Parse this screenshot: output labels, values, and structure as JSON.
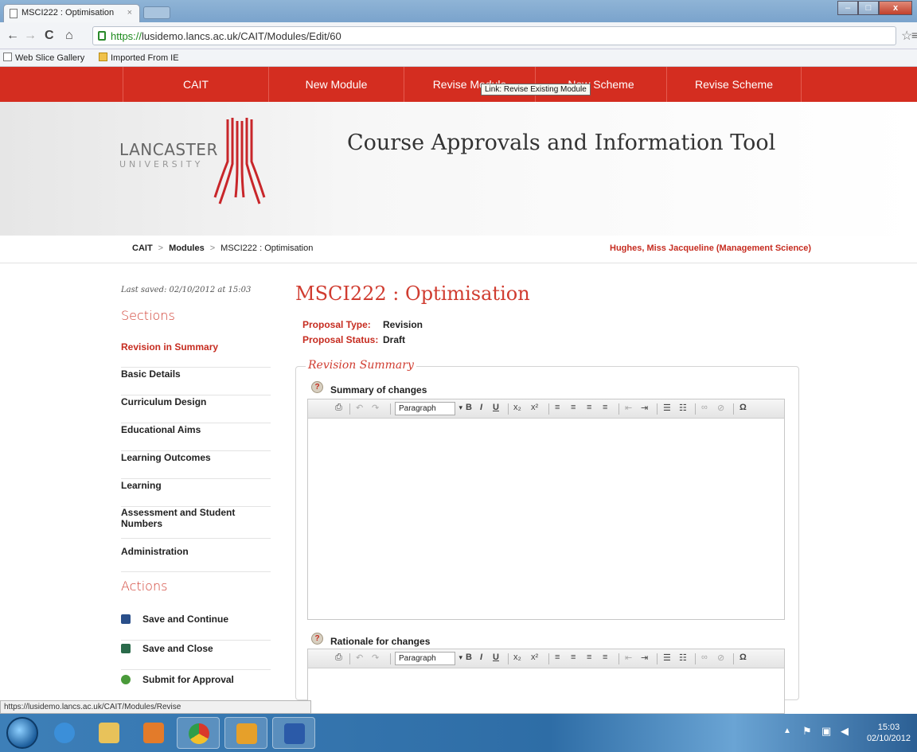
{
  "browser": {
    "tab_title": "MSCI222 : Optimisation",
    "tab_close": "×",
    "url_scheme": "https://",
    "url_rest": "lusidemo.lancs.ac.uk/CAIT/Modules/Edit/60",
    "bookmarks": [
      "Web Slice Gallery",
      "Imported From IE"
    ],
    "status_url": "https://lusidemo.lancs.ac.uk/CAIT/Modules/Revise"
  },
  "nav": {
    "items": [
      "CAIT",
      "New Module",
      "Revise Module",
      "New Scheme",
      "Revise Scheme"
    ],
    "tooltip": "Link: Revise Existing Module"
  },
  "header": {
    "logo_name": "LANCASTER",
    "logo_sub": "UNIVERSITY",
    "site_title": "Course Approvals and Information Tool"
  },
  "breadcrumb": {
    "items": [
      "CAIT",
      "Modules",
      "MSCI222 : Optimisation"
    ],
    "separator": ">",
    "user": "Hughes, Miss Jacqueline (Management Science)"
  },
  "sidebar": {
    "last_saved": "Last saved: 02/10/2012 at 15:03",
    "sections_heading": "Sections",
    "sections": [
      "Revision in Summary",
      "Basic Details",
      "Curriculum Design",
      "Educational Aims",
      "Learning Outcomes",
      "Learning",
      "Assessment and Student Numbers",
      "Administration"
    ],
    "actions_heading": "Actions",
    "actions": [
      {
        "label": "Save and Continue",
        "icon": "save-icon"
      },
      {
        "label": "Save and Close",
        "icon": "save-close-icon"
      },
      {
        "label": "Submit for Approval",
        "icon": "submit-icon"
      }
    ]
  },
  "main": {
    "title": "MSCI222 : Optimisation",
    "proposal_type_label": "Proposal Type:",
    "proposal_type": "Revision",
    "proposal_status_label": "Proposal Status:",
    "proposal_status": "Draft",
    "fieldset_legend": "Revision Summary",
    "fields": [
      {
        "label": "Summary of changes",
        "format": "Paragraph"
      },
      {
        "label": "Rationale for changes",
        "format": "Paragraph"
      }
    ],
    "help_glyph": "?"
  },
  "taskbar": {
    "time": "15:03",
    "date": "02/10/2012"
  },
  "colors": {
    "accent": "#d42d20",
    "heading": "#d03c30"
  }
}
